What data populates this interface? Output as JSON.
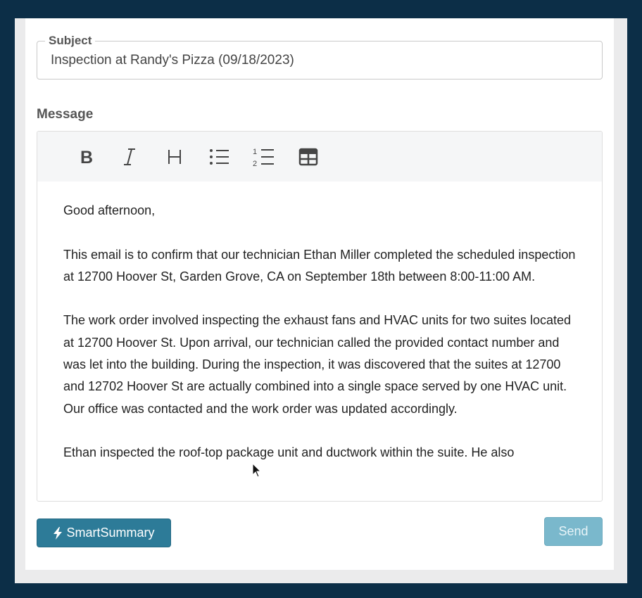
{
  "subject": {
    "legend": "Subject",
    "value": "Inspection at Randy's Pizza (09/18/2023)"
  },
  "message": {
    "label": "Message",
    "toolbar": [
      {
        "name": "bold",
        "icon": "bold-icon"
      },
      {
        "name": "italic",
        "icon": "italic-icon"
      },
      {
        "name": "heading",
        "icon": "heading-icon"
      },
      {
        "name": "bulleted-list",
        "icon": "bulleted-list-icon"
      },
      {
        "name": "numbered-list",
        "icon": "numbered-list-icon"
      },
      {
        "name": "table",
        "icon": "table-icon"
      }
    ],
    "paragraphs": [
      "Good afternoon,",
      "This email is to confirm that our technician Ethan Miller completed the scheduled inspection at 12700 Hoover St, Garden Grove, CA on September 18th between 8:00-11:00 AM.",
      "The work order involved inspecting the exhaust fans and HVAC units for two suites located at 12700 Hoover St. Upon arrival, our technician called the provided contact number and was let into the building. During the inspection, it was discovered that the suites at 12700 and 12702 Hoover St are actually combined into a single space served by one HVAC unit. Our office was contacted and the work order was updated accordingly.",
      "Ethan inspected the roof-top package unit and ductwork within the suite. He also"
    ]
  },
  "actions": {
    "smart_summary_label": "SmartSummary",
    "smart_summary_icon": "lightning-icon",
    "send_label": "Send"
  },
  "colors": {
    "background": "#0c2e47",
    "primary_button": "#2d7b98",
    "send_button_disabled": "#7ab8cc"
  }
}
